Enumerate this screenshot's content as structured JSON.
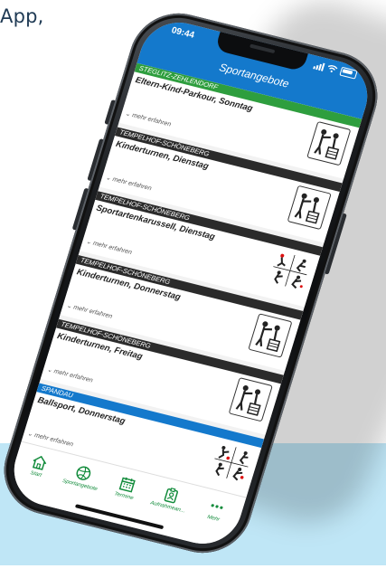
{
  "background_text": "App,",
  "status_bar": {
    "time": "09:44"
  },
  "header": {
    "title": "Sportangebote",
    "color": "#1479cc"
  },
  "cards": [
    {
      "district": "STEGLITZ-ZEHLENDORF",
      "district_color": "#2e9e3e",
      "title": "Eltern-Kind-Parkour, Sonntag",
      "more": "mehr erfahren",
      "icon": "gymnastics-icon"
    },
    {
      "district": "TEMPELHOF-SCHÖNEBERG",
      "district_color": "#2b2b2b",
      "title": "Kinderturnen, Dienstag",
      "more": "mehr erfahren",
      "icon": "gymnastics-icon"
    },
    {
      "district": "TEMPELHOF-SCHÖNEBERG",
      "district_color": "#2b2b2b",
      "title": "Sportartenkarussell, Dienstag",
      "more": "mehr erfahren",
      "icon": "multisport-icon"
    },
    {
      "district": "TEMPELHOF-SCHÖNEBERG",
      "district_color": "#2b2b2b",
      "title": "Kinderturnen, Donnerstag",
      "more": "mehr erfahren",
      "icon": "gymnastics-icon"
    },
    {
      "district": "TEMPELHOF-SCHÖNEBERG",
      "district_color": "#2b2b2b",
      "title": "Kinderturnen, Freitag",
      "more": "mehr erfahren",
      "icon": "gymnastics-icon"
    },
    {
      "district": "SPANDAU",
      "district_color": "#1479cc",
      "title": "Ballsport, Donnerstag",
      "more": "mehr erfahren",
      "icon": "ballsport-icon"
    }
  ],
  "tabs": [
    {
      "label": "Start",
      "icon": "home-icon"
    },
    {
      "label": "Sportangebote",
      "icon": "volleyball-icon"
    },
    {
      "label": "Termine",
      "icon": "calendar-icon"
    },
    {
      "label": "Aufnahmean...",
      "icon": "id-badge-icon"
    },
    {
      "label": "Mehr",
      "icon": "more-icon"
    }
  ],
  "accent_green": "#138c3c"
}
